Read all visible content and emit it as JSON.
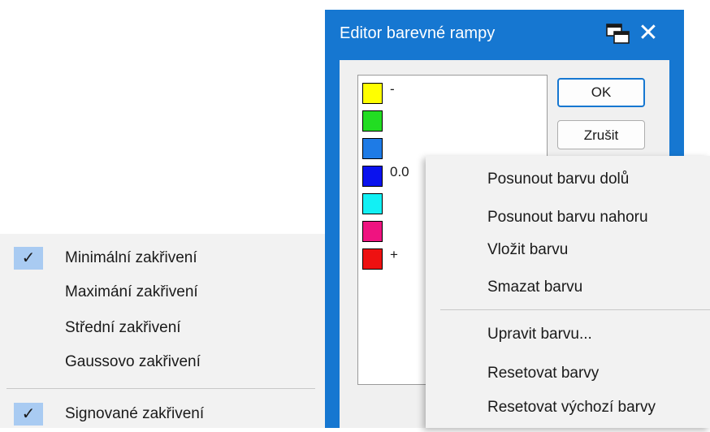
{
  "left_menu": {
    "items": [
      {
        "label": "Minimální zakřivení",
        "checked": true
      },
      {
        "label": "Maximání zakřivení",
        "checked": false
      },
      {
        "label": "Střední zakřivení",
        "checked": false
      },
      {
        "label": "Gaussovo zakřivení",
        "checked": false
      },
      {
        "label": "Signované zakřivení",
        "checked": true
      }
    ],
    "check_glyph": "✓"
  },
  "dialog": {
    "title": "Editor barevné rampy",
    "close_glyph": "✕",
    "ok_label": "OK",
    "cancel_label": "Zrušit",
    "ramp": [
      {
        "color": "#ffff00",
        "label": "-"
      },
      {
        "color": "#22dd22",
        "label": ""
      },
      {
        "color": "#1e7be6",
        "label": ""
      },
      {
        "color": "#0a12ee",
        "label": "0.0"
      },
      {
        "color": "#12f0f4",
        "label": ""
      },
      {
        "color": "#ef1380",
        "label": ""
      },
      {
        "color": "#ee1111",
        "label": "+"
      }
    ]
  },
  "context_menu": {
    "items": [
      "Posunout barvu dolů",
      "Posunout barvu nahoru",
      "Vložit barvu",
      "Smazat barvu",
      "Upravit barvu...",
      "Resetovat barvy",
      "Resetovat výchozí barvy"
    ]
  },
  "colors": {
    "accent": "#1677d1",
    "check_highlight": "#a9cbf2",
    "menu_background": "#f2f2f2"
  }
}
